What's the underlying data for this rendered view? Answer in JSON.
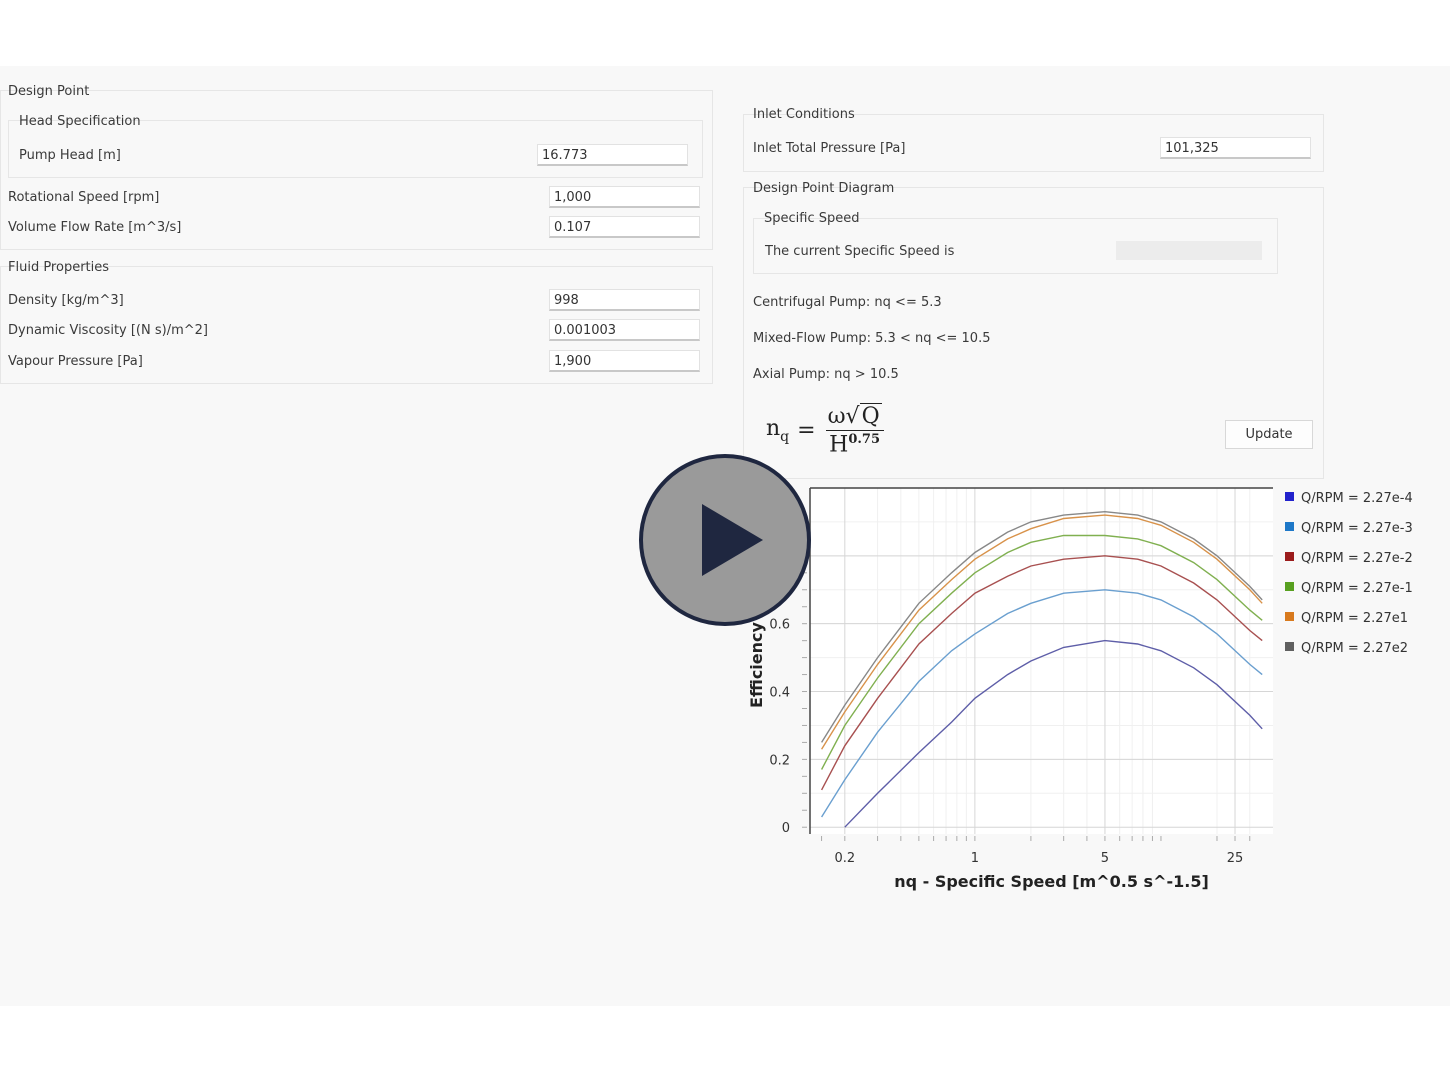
{
  "design_point": {
    "title": "Design Point",
    "head_spec": {
      "title": "Head Specification",
      "pump_head_label": "Pump Head  [m]",
      "pump_head_value": "16.773"
    },
    "rotational_speed_label": "Rotational Speed  [rpm]",
    "rotational_speed_value": "1,000",
    "volume_flow_label": "Volume Flow Rate  [m^3/s]",
    "volume_flow_value": "0.107"
  },
  "fluid": {
    "title": "Fluid Properties",
    "density_label": "Density  [kg/m^3]",
    "density_value": "998",
    "viscosity_label": "Dynamic Viscosity  [(N s)/m^2]",
    "viscosity_value": "0.001003",
    "vapour_label": "Vapour Pressure  [Pa]",
    "vapour_value": "1,900"
  },
  "inlet": {
    "title": "Inlet Conditions",
    "pressure_label": "Inlet Total Pressure  [Pa]",
    "pressure_value": "101,325"
  },
  "diagram": {
    "title": "Design Point Diagram",
    "specific_speed": {
      "title": "Specific Speed",
      "current_label": "The current Specific Speed is",
      "current_value": ""
    },
    "centrifugal": "Centrifugal Pump: nq <= 5.3",
    "mixed": "Mixed-Flow Pump: 5.3 < nq <= 10.5",
    "axial": "Axial Pump: nq > 10.5",
    "formula": {
      "lhs": "n",
      "lhs_sub": "q",
      "eq": "=",
      "num_omega": "ω",
      "num_q": "Q",
      "den_h": "H",
      "den_exp": "0.75"
    },
    "update_button": "Update"
  },
  "chart_data": {
    "type": "line",
    "title": "",
    "xlabel": "nq - Specific Speed [m^0.5 s^-1.5]",
    "ylabel": "Efficiency",
    "x_scale": "log",
    "xlim": [
      0.13,
      40
    ],
    "ylim": [
      -0.02,
      1.0
    ],
    "x_ticks": [
      0.2,
      1,
      5,
      25
    ],
    "x_tick_labels": [
      "0.2",
      "1",
      "5",
      "25"
    ],
    "y_ticks": [
      0,
      0.2,
      0.4,
      0.6
    ],
    "y_tick_labels": [
      "0",
      "0.2",
      "0.4",
      "0.6"
    ],
    "grid": true,
    "legend_position": "right",
    "x": [
      0.15,
      0.2,
      0.3,
      0.5,
      0.75,
      1,
      1.5,
      2,
      3,
      5,
      7.5,
      10,
      15,
      20,
      30,
      35
    ],
    "series": [
      {
        "name": "Q/RPM = 2.27e-4",
        "color": "#2222cc",
        "line_color": "#5e5ea8",
        "values": [
          null,
          0.0,
          0.1,
          0.22,
          0.31,
          0.38,
          0.45,
          0.49,
          0.53,
          0.55,
          0.54,
          0.52,
          0.47,
          0.42,
          0.33,
          0.29
        ]
      },
      {
        "name": "Q/RPM = 2.27e-3",
        "color": "#1e78c8",
        "line_color": "#6a9fcf",
        "values": [
          0.03,
          0.14,
          0.28,
          0.43,
          0.52,
          0.57,
          0.63,
          0.66,
          0.69,
          0.7,
          0.69,
          0.67,
          0.62,
          0.57,
          0.48,
          0.45
        ]
      },
      {
        "name": "Q/RPM = 2.27e-2",
        "color": "#9b1c1c",
        "line_color": "#a85050",
        "values": [
          0.11,
          0.24,
          0.38,
          0.54,
          0.63,
          0.69,
          0.74,
          0.77,
          0.79,
          0.8,
          0.79,
          0.77,
          0.72,
          0.67,
          0.58,
          0.55
        ]
      },
      {
        "name": "Q/RPM = 2.27e-1",
        "color": "#58a020",
        "line_color": "#80b050",
        "values": [
          0.17,
          0.3,
          0.44,
          0.6,
          0.69,
          0.75,
          0.81,
          0.84,
          0.86,
          0.86,
          0.85,
          0.83,
          0.78,
          0.73,
          0.64,
          0.61
        ]
      },
      {
        "name": "Q/RPM = 2.27e1",
        "color": "#d87a1e",
        "line_color": "#d8924a",
        "values": [
          0.23,
          0.34,
          0.48,
          0.64,
          0.73,
          0.79,
          0.85,
          0.88,
          0.91,
          0.92,
          0.91,
          0.89,
          0.84,
          0.79,
          0.7,
          0.66
        ]
      },
      {
        "name": "Q/RPM = 2.27e2",
        "color": "#606060",
        "line_color": "#888888",
        "values": [
          0.25,
          0.36,
          0.5,
          0.66,
          0.75,
          0.81,
          0.87,
          0.9,
          0.92,
          0.93,
          0.92,
          0.9,
          0.85,
          0.8,
          0.71,
          0.67
        ]
      }
    ]
  },
  "icons": {
    "play": "play-icon"
  }
}
